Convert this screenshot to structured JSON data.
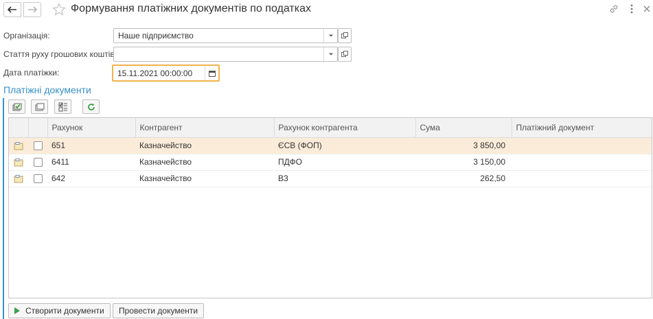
{
  "window": {
    "title": "Формування платіжних документів по податках"
  },
  "form": {
    "organization": {
      "label": "Організація:",
      "value": "Наше підприємство"
    },
    "cash_flow": {
      "label": "Стаття руху грошових коштів:",
      "value": ""
    },
    "payment_date": {
      "label": "Дата платіжки:",
      "value": "15.11.2021 00:00:00"
    }
  },
  "section": {
    "title": "Платіжні документи"
  },
  "table": {
    "columns": {
      "account": "Рахунок",
      "counterparty": "Контрагент",
      "counterparty_account": "Рахунок контрагента",
      "amount": "Сума",
      "payment_doc": "Платіжний документ"
    },
    "rows": [
      {
        "account": "651",
        "counterparty": "Казначейство",
        "counterparty_account": "ЄСВ (ФОП)",
        "amount": "3 850,00",
        "payment_doc": "",
        "checked": false
      },
      {
        "account": "6411",
        "counterparty": "Казначейство",
        "counterparty_account": "ПДФО",
        "amount": "3 150,00",
        "payment_doc": "",
        "checked": false
      },
      {
        "account": "642",
        "counterparty": "Казначейство",
        "counterparty_account": "ВЗ",
        "amount": "262,50",
        "payment_doc": "",
        "checked": false
      }
    ]
  },
  "buttons": {
    "create": "Створити документи",
    "post": "Провести документи"
  },
  "colors": {
    "accent": "#3a8fc3",
    "selected_row": "#fbecd9",
    "focus_border": "#f0b44c",
    "play": "#3aa14a"
  }
}
